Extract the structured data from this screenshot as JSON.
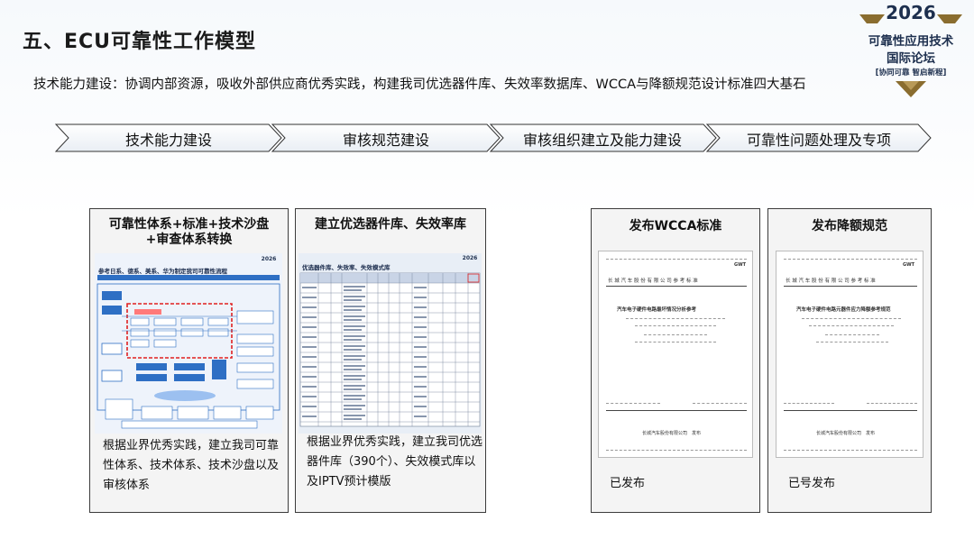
{
  "header": {
    "title": "五、ECU可靠性工作模型",
    "subtitle": "技术能力建设：协调内部资源，吸收外部供应商优秀实践，构建我司优选器件库、失效率数据库、WCCA与降额规范设计标准四大基石"
  },
  "logo": {
    "year": "2026",
    "line1": "可靠性应用技术",
    "line2": "国际论坛",
    "tagline": "[协同可靠 智启新程]"
  },
  "process_steps": [
    {
      "label": "技术能力建设"
    },
    {
      "label": "审核规范建设"
    },
    {
      "label": "审核组织建立及能力建设"
    },
    {
      "label": "可靠性问题处理及专项"
    }
  ],
  "cards": {
    "card1": {
      "title_line1": "可靠性体系+标准+技术沙盘",
      "title_line2": "+审查体系转换",
      "image_heading": "参考日系、德系、美系、华为制定我司可靠性流程",
      "image_logo_year": "2026",
      "desc_line1": "根据业界优秀实践，建立我司可靠",
      "desc_line2": "性体系、技术体系、技术沙盘以及",
      "desc_line3": "审核体系"
    },
    "card2": {
      "title": "建立优选器件库、失效率库",
      "image_heading": "优选器件库、失效率、失效模式库",
      "image_logo_year": "2026",
      "desc_line1": "根据业界优秀实践，建立我司优选",
      "desc_line2": "器件库（390个）、失效模式库以",
      "desc_line3": "及IPTV预计模版"
    },
    "card3": {
      "title": "发布WCCA标准",
      "doc_header": "长 城 汽 车 股 份 有 限 公 司 参 考 标 准",
      "doc_title": "汽车电子硬件电路最坏情况分析参考",
      "doc_footer": "长城汽车股份有限公司　发布",
      "status": "已发布"
    },
    "card4": {
      "title": "发布降额规范",
      "doc_header": "长 城 汽 车 股 份 有 限 公 司 参 考 标 准",
      "doc_title": "汽车电子硬件电路元器件应力降额参考规范",
      "doc_footer": "长城汽车股份有限公司　发布",
      "status": "已号发布"
    }
  },
  "colors": {
    "accent_gold": "#8a6d2f",
    "logo_navy": "#1d2f4e",
    "card_border": "#3c3c3c",
    "card_bg": "#f4f4f4",
    "diagram_blue": "#2e6fc4",
    "highlight_red": "#e02020"
  }
}
